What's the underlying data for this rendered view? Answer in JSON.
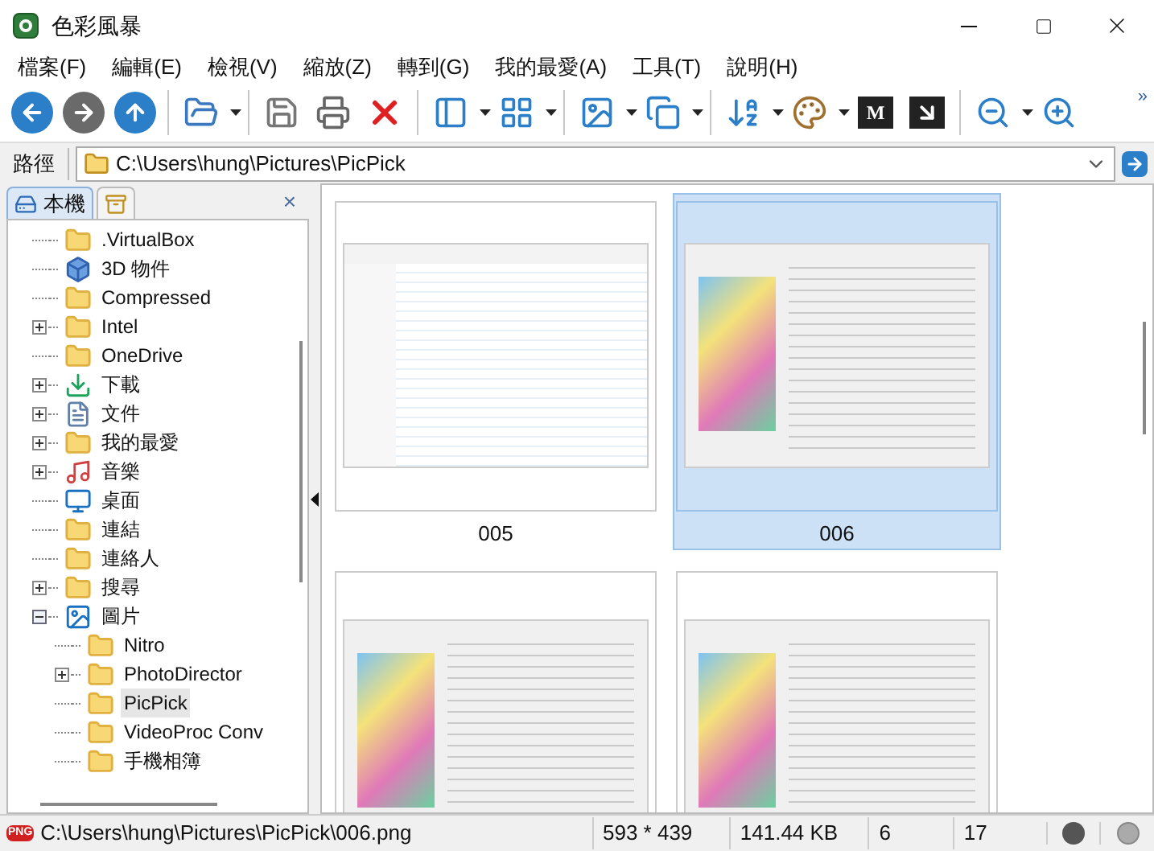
{
  "window": {
    "title": "色彩風暴"
  },
  "menu": [
    "檔案(F)",
    "編輯(E)",
    "檢視(V)",
    "縮放(Z)",
    "轉到(G)",
    "我的最愛(A)",
    "工具(T)",
    "說明(H)"
  ],
  "toolbar": {
    "metadata_label": "M",
    "overflow": "»"
  },
  "address": {
    "label": "路徑",
    "value": "C:\\Users\\hung\\Pictures\\PicPick"
  },
  "panel": {
    "tabs": [
      {
        "label": "本機",
        "kind": "computer",
        "selected": true
      },
      {
        "kind": "archive",
        "selected": false
      }
    ],
    "close": "×"
  },
  "tree": [
    {
      "label": ".VirtualBox",
      "kind": "folder",
      "selected": false
    },
    {
      "label": "3D 物件",
      "kind": "cube",
      "selected": false
    },
    {
      "label": "Compressed",
      "kind": "folder",
      "selected": false
    },
    {
      "label": "Intel",
      "kind": "folder",
      "expanded": false,
      "selected": false
    },
    {
      "label": "OneDrive",
      "kind": "folder",
      "selected": false
    },
    {
      "label": "下載",
      "kind": "download",
      "expanded": false,
      "selected": false
    },
    {
      "label": "文件",
      "kind": "document",
      "expanded": false,
      "selected": false
    },
    {
      "label": "我的最愛",
      "kind": "folder",
      "expanded": false,
      "selected": false
    },
    {
      "label": "音樂",
      "kind": "music",
      "expanded": false,
      "selected": false
    },
    {
      "label": "桌面",
      "kind": "desktop",
      "selected": false
    },
    {
      "label": "連結",
      "kind": "folder",
      "selected": false
    },
    {
      "label": "連絡人",
      "kind": "folder",
      "selected": false
    },
    {
      "label": "搜尋",
      "kind": "folder",
      "expanded": false,
      "selected": false
    },
    {
      "label": "圖片",
      "kind": "picture",
      "expanded": true,
      "selected": false,
      "children": [
        {
          "label": "Nitro",
          "kind": "folder",
          "selected": false
        },
        {
          "label": "PhotoDirector",
          "kind": "folder",
          "expanded": false,
          "selected": false
        },
        {
          "label": "PicPick",
          "kind": "folder",
          "selected": true
        },
        {
          "label": "VideoProc Conv",
          "kind": "folder",
          "selected": false
        },
        {
          "label": "手機相簿",
          "kind": "folder",
          "selected": false
        }
      ]
    }
  ],
  "thumbnails": [
    {
      "caption": "005",
      "kind": "explorer",
      "selected": false
    },
    {
      "caption": "006",
      "kind": "dialog",
      "selected": true
    },
    {
      "kind": "dialog",
      "selected": false
    },
    {
      "kind": "dialog",
      "selected": false
    }
  ],
  "status_bar": {
    "file_type": "PNG",
    "path": "C:\\Users\\hung\\Pictures\\PicPick\\006.png",
    "dimensions": "593 * 439",
    "size": "141.44 KB",
    "index": "6",
    "count": "17"
  }
}
